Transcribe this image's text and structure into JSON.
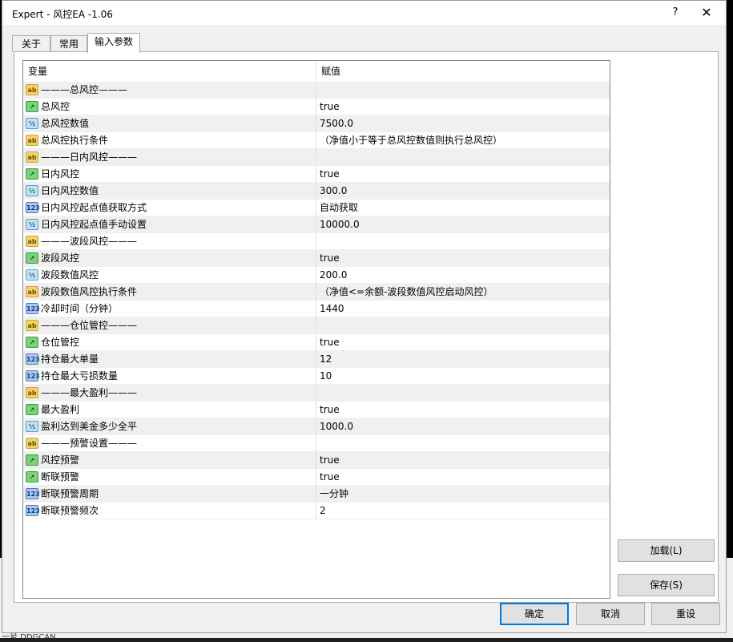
{
  "window": {
    "title": "Expert - 风控EA -1.06",
    "help_glyph": "?",
    "close_glyph": "✕"
  },
  "tabs": [
    {
      "label": "关于"
    },
    {
      "label": "常用"
    },
    {
      "label": "输入参数"
    }
  ],
  "table": {
    "headers": {
      "variable": "变量",
      "value": "赋值"
    },
    "rows": [
      {
        "type": "ab",
        "name": "———总风控———",
        "value": ""
      },
      {
        "type": "bool",
        "name": "总风控",
        "value": "true"
      },
      {
        "type": "dbl",
        "name": "总风控数值",
        "value": "7500.0"
      },
      {
        "type": "ab",
        "name": "总风控执行条件",
        "value": "（净值小于等于总风控数值则执行总风控）"
      },
      {
        "type": "ab",
        "name": "———日内风控———",
        "value": ""
      },
      {
        "type": "bool",
        "name": "日内风控",
        "value": "true"
      },
      {
        "type": "dbl",
        "name": "日内风控数值",
        "value": "300.0"
      },
      {
        "type": "int",
        "name": "日内风控起点值获取方式",
        "value": "自动获取"
      },
      {
        "type": "dbl",
        "name": "日内风控起点值手动设置",
        "value": "10000.0"
      },
      {
        "type": "ab",
        "name": "———波段风控———",
        "value": ""
      },
      {
        "type": "bool",
        "name": "波段风控",
        "value": "true"
      },
      {
        "type": "dbl",
        "name": "波段数值风控",
        "value": "200.0"
      },
      {
        "type": "ab",
        "name": "波段数值风控执行条件",
        "value": "（净值<=余额-波段数值风控启动风控）"
      },
      {
        "type": "int",
        "name": "冷却时间（分钟）",
        "value": "1440"
      },
      {
        "type": "ab",
        "name": "———仓位管控———",
        "value": ""
      },
      {
        "type": "bool",
        "name": "仓位管控",
        "value": "true"
      },
      {
        "type": "int",
        "name": "持仓最大单量",
        "value": "12"
      },
      {
        "type": "int",
        "name": "持仓最大亏损数量",
        "value": "10"
      },
      {
        "type": "ab",
        "name": "———最大盈利———",
        "value": ""
      },
      {
        "type": "bool",
        "name": "最大盈利",
        "value": "true"
      },
      {
        "type": "dbl",
        "name": "盈利达到美金多少全平",
        "value": "1000.0"
      },
      {
        "type": "ab",
        "name": "———预警设置———",
        "value": ""
      },
      {
        "type": "bool",
        "name": "风控预警",
        "value": "true"
      },
      {
        "type": "bool",
        "name": "断联预警",
        "value": "true"
      },
      {
        "type": "int",
        "name": "断联预警周期",
        "value": "一分钟"
      },
      {
        "type": "int",
        "name": "断联预警频次",
        "value": "2"
      }
    ]
  },
  "icon_labels": {
    "ab": "ab",
    "bool": "↗",
    "dbl": "½",
    "int": "123"
  },
  "buttons": {
    "load": "加载(L)",
    "save": "保存(S)",
    "ok": "确定",
    "cancel": "取消",
    "reset": "重设"
  },
  "background": {
    "status_text": "一号  DDGCAN"
  }
}
